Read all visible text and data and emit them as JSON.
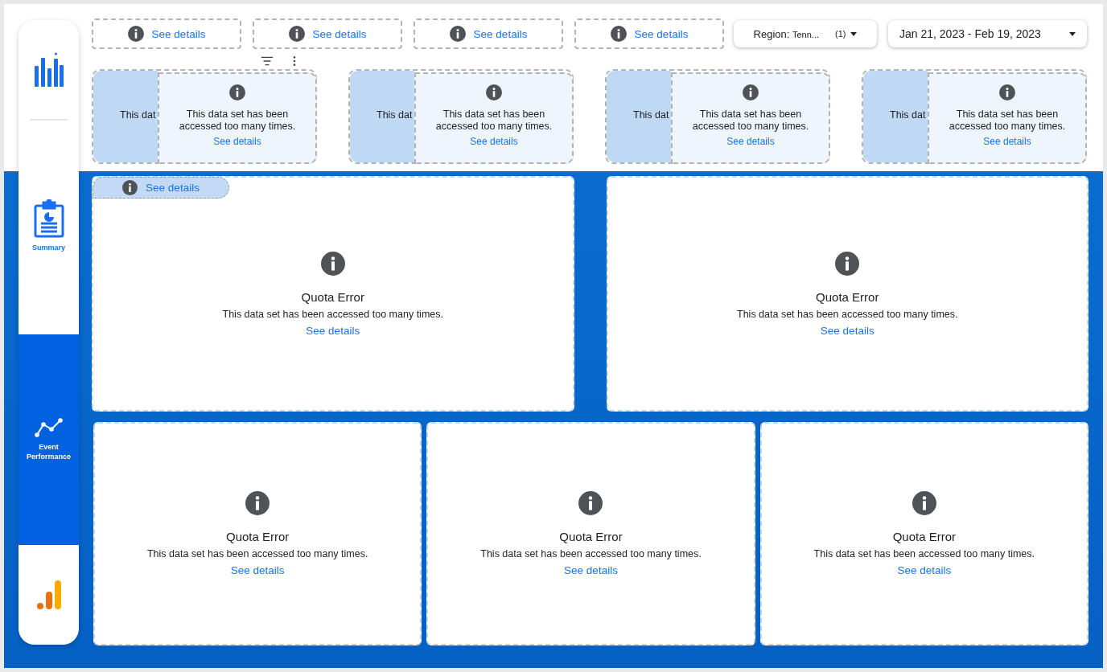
{
  "sidebar": {
    "items": [
      {
        "kind": "logo"
      },
      {
        "kind": "page",
        "label": "Summary",
        "selected": false
      },
      {
        "kind": "page",
        "label": "Event Performance",
        "selected": true
      },
      {
        "kind": "analytics"
      }
    ]
  },
  "top_links": [
    {
      "label": "See details"
    },
    {
      "label": "See details"
    },
    {
      "label": "See details"
    },
    {
      "label": "See details"
    }
  ],
  "region_filter": {
    "label": "Region:",
    "value": "Tenn...",
    "count": "(1)"
  },
  "date_range": {
    "value": "Jan 21, 2023 - Feb 19, 2023"
  },
  "scorecards": [
    {
      "back_text": "This dat",
      "message": "This data set has been accessed too many times.",
      "link": "See details"
    },
    {
      "back_text": "This dat",
      "message": "This data set has been accessed too many times.",
      "link": "See details"
    },
    {
      "back_text": "This dat",
      "message": "This data set has been accessed too many times.",
      "link": "See details"
    },
    {
      "back_text": "This dat",
      "message": "This data set has been accessed too many times.",
      "link": "See details"
    }
  ],
  "floating_link": {
    "label": "See details"
  },
  "panels": [
    {
      "title": "Quota Error",
      "message": "This data set has been accessed too many times.",
      "link": "See details"
    },
    {
      "title": "Quota Error",
      "message": "This data set has been accessed too many times.",
      "link": "See details"
    },
    {
      "title": "Quota Error",
      "message": "This data set has been accessed too many times.",
      "link": "See details"
    },
    {
      "title": "Quota Error",
      "message": "This data set has been accessed too many times.",
      "link": "See details"
    },
    {
      "title": "Quota Error",
      "message": "This data set has been accessed too many times.",
      "link": "See details"
    }
  ]
}
